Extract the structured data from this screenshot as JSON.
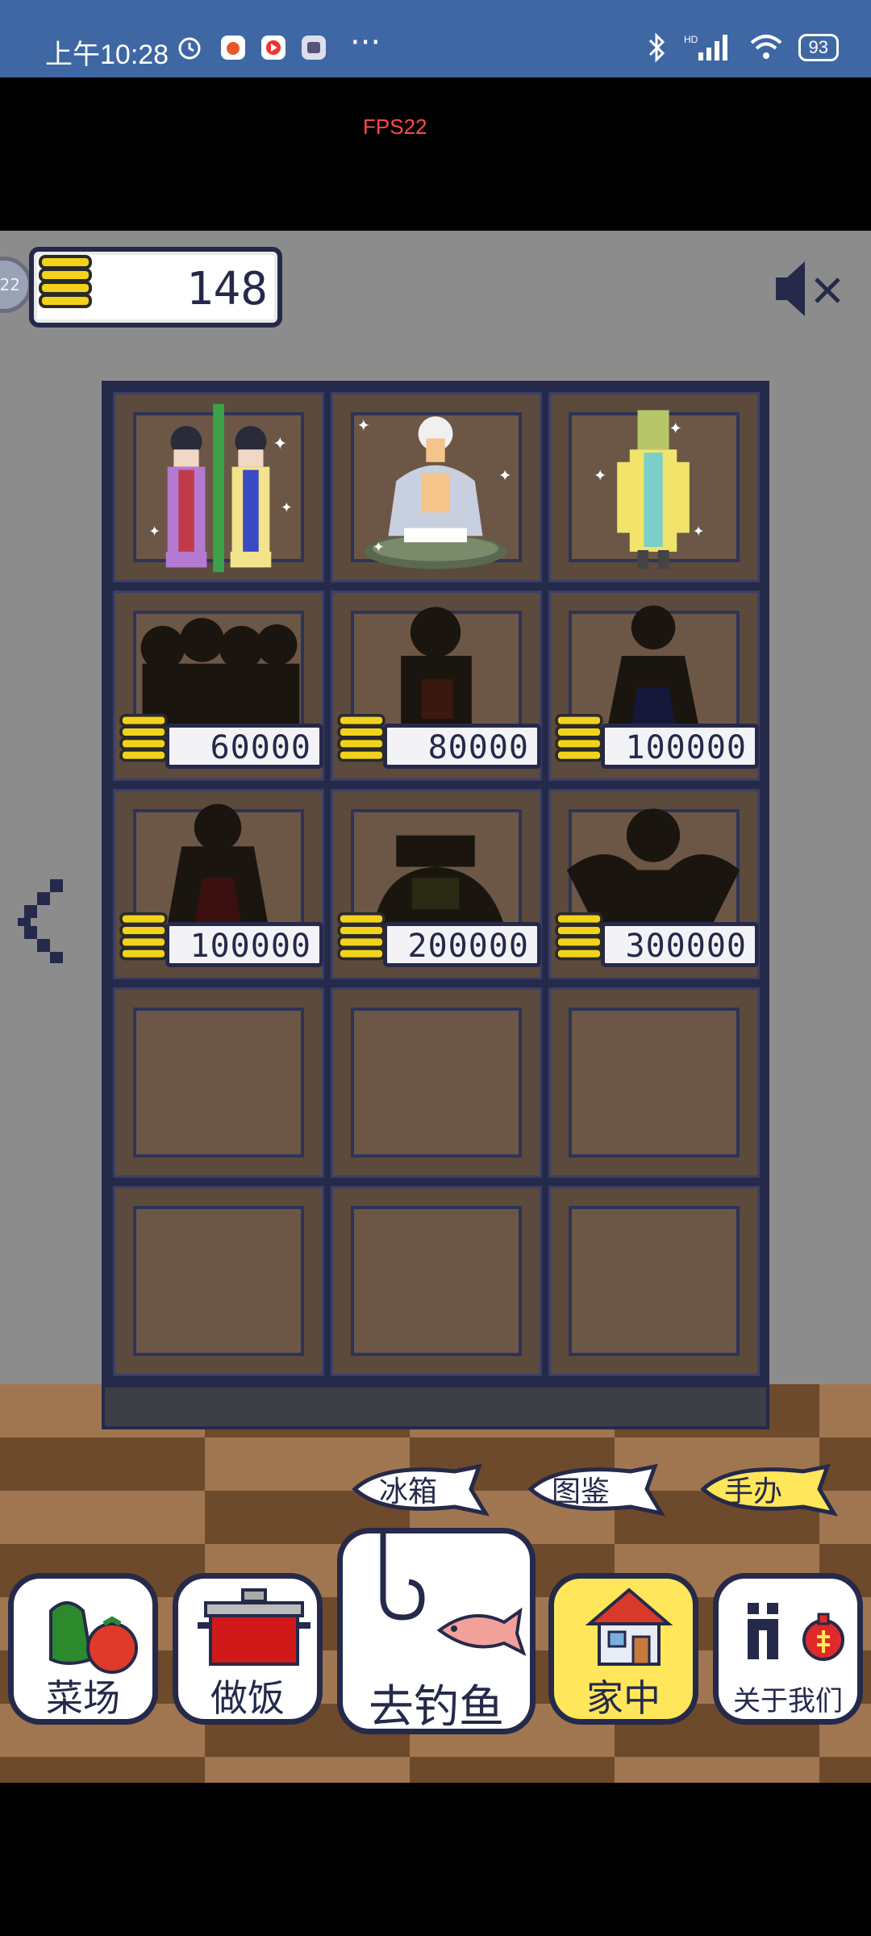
{
  "status_bar": {
    "time": "上午10:28",
    "battery": "93",
    "network": "HD"
  },
  "fps_label": "FPS22",
  "coins": {
    "amount": "148"
  },
  "left_badge": "22",
  "shelf": {
    "slots": [
      {
        "state": "owned",
        "figure": "twin-maidens-with-bamboo"
      },
      {
        "state": "owned",
        "figure": "old-sage-on-turtle"
      },
      {
        "state": "owned",
        "figure": "dragon-king"
      },
      {
        "state": "locked",
        "price": "60000"
      },
      {
        "state": "locked",
        "price": "80000"
      },
      {
        "state": "locked",
        "price": "100000"
      },
      {
        "state": "locked",
        "price": "100000"
      },
      {
        "state": "locked",
        "price": "200000"
      },
      {
        "state": "locked",
        "price": "300000"
      },
      {
        "state": "empty"
      },
      {
        "state": "empty"
      },
      {
        "state": "empty"
      },
      {
        "state": "empty"
      },
      {
        "state": "empty"
      },
      {
        "state": "empty"
      }
    ]
  },
  "tabs": {
    "fridge": "冰箱",
    "catalog": "图鉴",
    "figures": "手办",
    "active": "figures"
  },
  "nav": {
    "farm": "菜场",
    "cook": "做饭",
    "fishing": "去钓鱼",
    "home": "家中",
    "about": "关于我们",
    "active": "home"
  },
  "colors": {
    "frame": "#25294a",
    "coin": "#f3d21c",
    "active_tab": "#ffe65a",
    "status_bar": "#3e67a4"
  }
}
